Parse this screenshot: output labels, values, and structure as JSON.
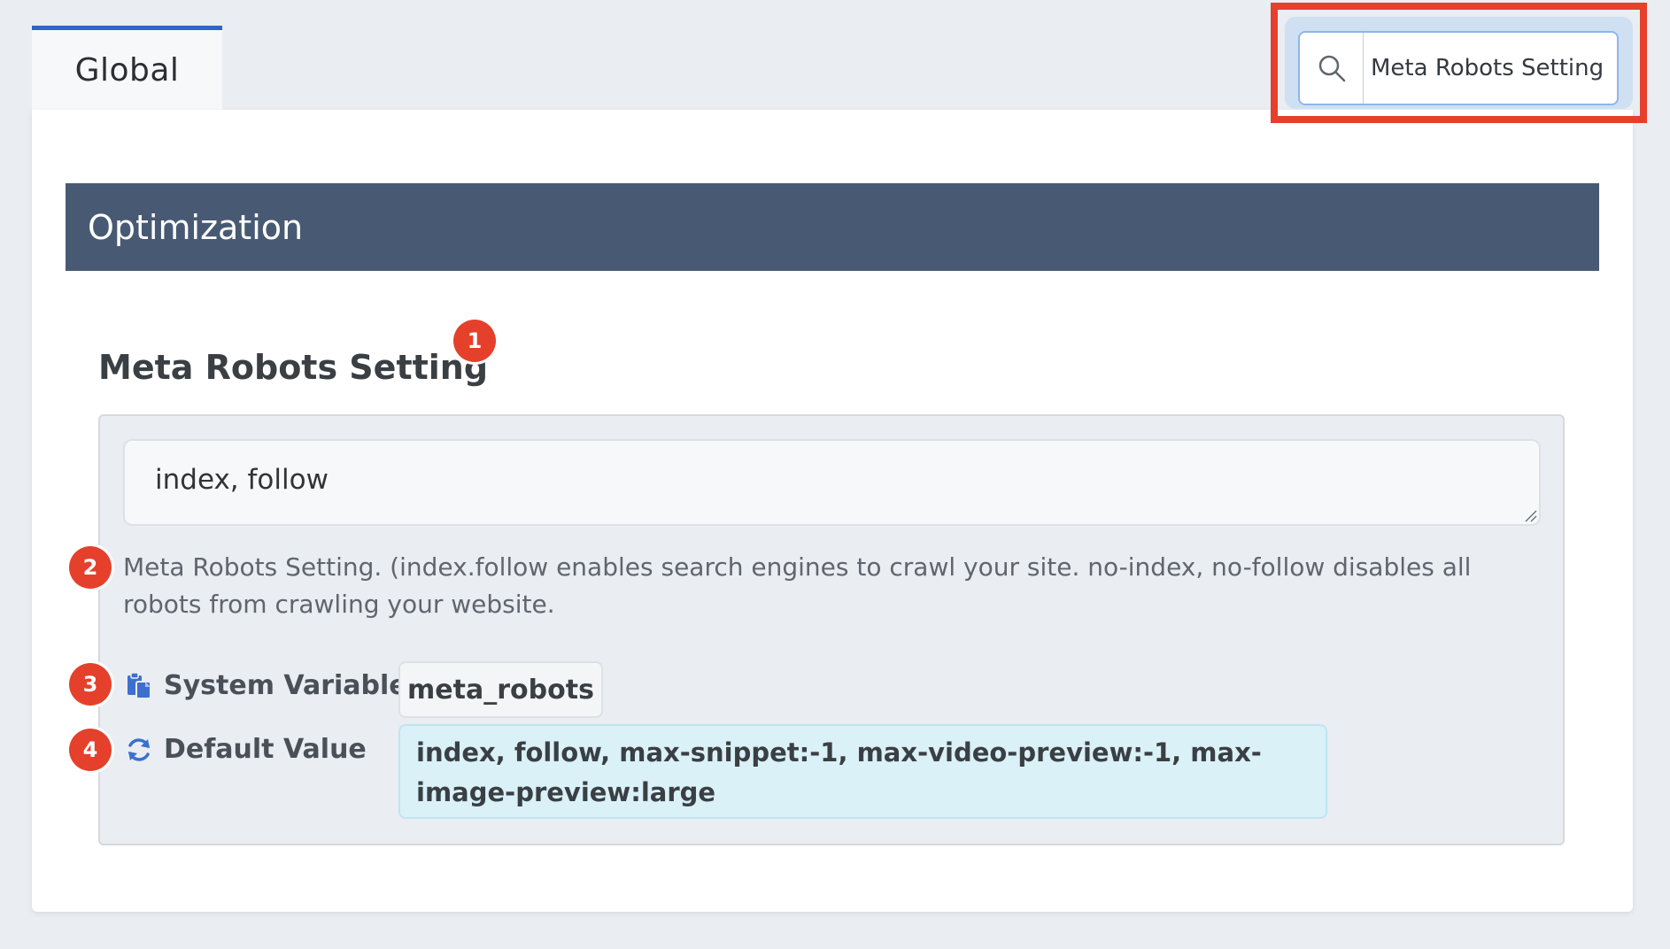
{
  "tabs": [
    {
      "label": "Global"
    }
  ],
  "search": {
    "value": "Meta Robots Setting"
  },
  "section": {
    "title": "Optimization"
  },
  "setting": {
    "title": "Meta Robots Setting",
    "value": "index, follow",
    "help": "Meta Robots Setting. (index.follow enables search engines to crawl your site. no-index, no-follow disables all robots from crawling your website.",
    "system_variable_label": "System Variable",
    "system_variable": "meta_robots",
    "default_value_label": "Default Value",
    "default_value": "index, follow, max-snippet:-1, max-video-preview:-1, max-image-preview:large"
  },
  "markers": [
    "1",
    "2",
    "3",
    "4"
  ],
  "icons": {
    "search": "search-icon",
    "system_variable": "clipboard-icon",
    "default_value": "refresh-icon"
  },
  "colors": {
    "accent": "#2f66c5",
    "section_header": "#485a73",
    "marker": "#e5402c",
    "highlight": "#e5402c",
    "default_value_bg": "#d9f1f7"
  }
}
